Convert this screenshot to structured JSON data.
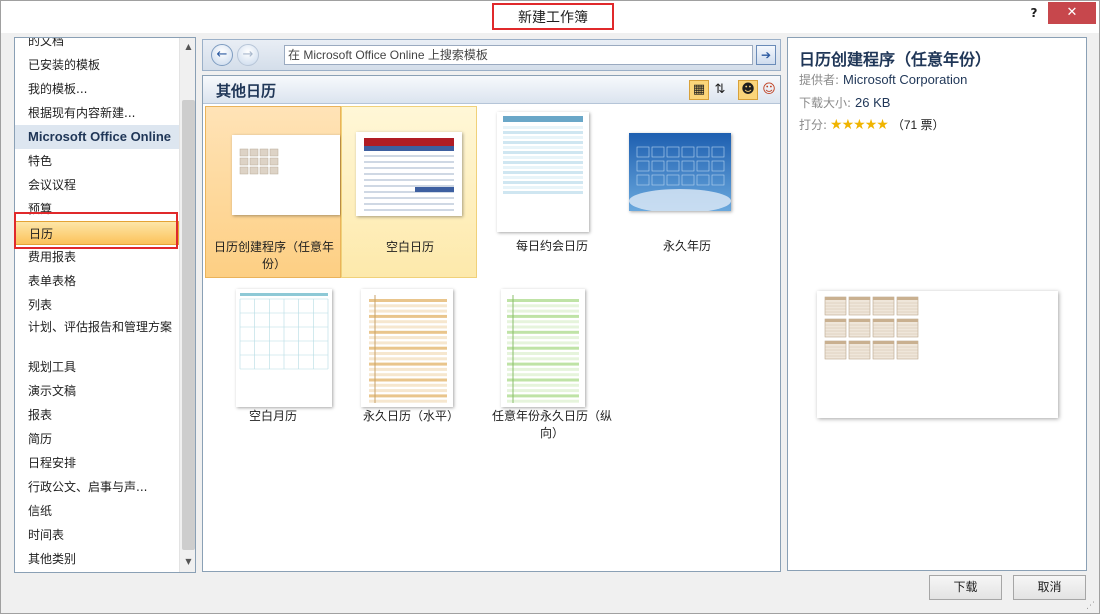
{
  "title": "新建工作簿",
  "titlebar": {
    "help_label": "?",
    "close_label": "✕"
  },
  "left_nav": {
    "items": [
      {
        "label": "的文档",
        "type": "normal"
      },
      {
        "label": "已安装的模板",
        "type": "normal"
      },
      {
        "label": "我的模板...",
        "type": "normal"
      },
      {
        "label": "根据现有内容新建...",
        "type": "normal"
      },
      {
        "label": "Microsoft Office Online",
        "type": "header"
      },
      {
        "label": "特色",
        "type": "normal"
      },
      {
        "label": "会议议程",
        "type": "normal"
      },
      {
        "label": "预算",
        "type": "normal"
      },
      {
        "label": "日历",
        "type": "selected"
      },
      {
        "label": "费用报表",
        "type": "normal"
      },
      {
        "label": "表单表格",
        "type": "normal"
      },
      {
        "label": "列表",
        "type": "normal"
      },
      {
        "label": "计划、评估报告和管理方案",
        "type": "two-line"
      },
      {
        "label": "规划工具",
        "type": "normal"
      },
      {
        "label": "演示文稿",
        "type": "normal"
      },
      {
        "label": "报表",
        "type": "normal"
      },
      {
        "label": "简历",
        "type": "normal"
      },
      {
        "label": "日程安排",
        "type": "normal"
      },
      {
        "label": "行政公文、启事与声...",
        "type": "normal"
      },
      {
        "label": "信纸",
        "type": "normal"
      },
      {
        "label": "时间表",
        "type": "normal"
      },
      {
        "label": "其他类别",
        "type": "normal"
      }
    ]
  },
  "search": {
    "value": "在 Microsoft Office Online 上搜索模板"
  },
  "gallery": {
    "title": "其他日历",
    "templates": [
      {
        "label": "日历创建程序（任意年份）",
        "state": "active",
        "thumb": "multi-month"
      },
      {
        "label": "空白日历",
        "state": "hover",
        "thumb": "red-header"
      },
      {
        "label": "每日约会日历",
        "state": "normal",
        "thumb": "blue-lines"
      },
      {
        "label": "永久年历",
        "state": "normal",
        "thumb": "sky-photo"
      },
      {
        "label": "空白月历",
        "state": "normal",
        "thumb": "month-grid"
      },
      {
        "label": "永久日历（水平）",
        "state": "normal",
        "thumb": "tan-lines"
      },
      {
        "label": "任意年份永久日历（纵向）",
        "state": "normal",
        "thumb": "green-lines"
      }
    ]
  },
  "preview": {
    "title": "日历创建程序（任意年份）",
    "provider_label": "提供者:",
    "provider": "Microsoft Corporation",
    "size_label": "下载大小:",
    "size": "26 KB",
    "rating_label": "打分:",
    "rating": 5,
    "votes": "（71 票）"
  },
  "buttons": {
    "download": "下载",
    "cancel": "取消"
  },
  "colors": {
    "accent": "#e0292b",
    "selection": "#fbc25a",
    "link": "#1f3657"
  }
}
